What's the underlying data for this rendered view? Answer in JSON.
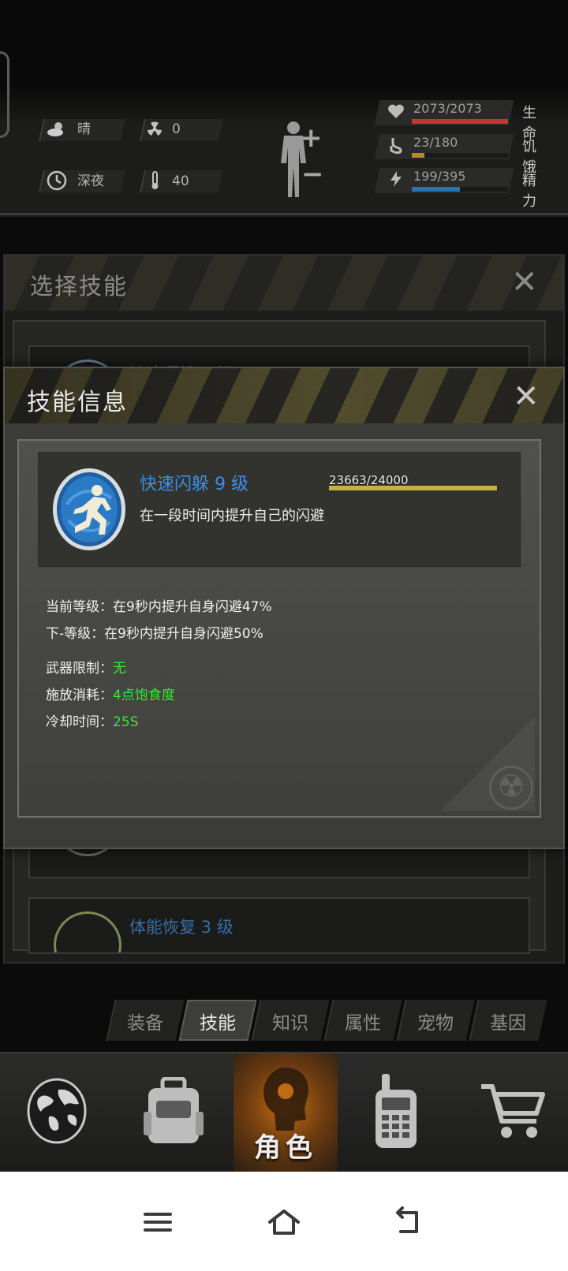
{
  "status": {
    "weather": "晴",
    "radiation": "0",
    "time_of_day": "深夜",
    "temperature": "40"
  },
  "vitals": [
    {
      "value": "2073/2073",
      "label": "生命",
      "color": "#c0392b",
      "fraction": 1.0,
      "icon": "heart-icon"
    },
    {
      "value": "23/180",
      "label": "饥饿",
      "color": "#b58a2a",
      "fraction": 0.128,
      "icon": "stomach-icon"
    },
    {
      "value": "199/395",
      "label": "精力",
      "color": "#2f6fb5",
      "fraction": 0.504,
      "icon": "energy-icon"
    }
  ],
  "select_panel": {
    "title": "选择技能",
    "items": [
      {
        "name": "快速闪躲 9 级"
      },
      {
        "name": "体能恢复 3 级"
      }
    ]
  },
  "info_modal": {
    "title": "技能信息",
    "skill": {
      "name": "快速闪躲 9 级",
      "description": "在一段时间内提升自己的闪避",
      "exp_text": "23663/24000",
      "exp_fraction": 0.986
    },
    "current_level": "当前等级：在9秒内提升自身闪避47%",
    "next_level": "下-等级：在9秒内提升自身闪避50%",
    "weapon_label": "武器限制：",
    "weapon_value": "无",
    "cost_label": "施放消耗：",
    "cost_value": "4点饱食度",
    "cooldown_label": "冷却时间：",
    "cooldown_value": "25S"
  },
  "tabs": [
    {
      "label": "装备",
      "active": false
    },
    {
      "label": "技能",
      "active": true
    },
    {
      "label": "知识",
      "active": false
    },
    {
      "label": "属性",
      "active": false
    },
    {
      "label": "宠物",
      "active": false
    },
    {
      "label": "基因",
      "active": false
    }
  ],
  "bottom_nav": {
    "active_label": "角色",
    "items": [
      "globe-icon",
      "backpack-icon",
      "character-icon",
      "radio-icon",
      "cart-icon"
    ]
  },
  "colors": {
    "accent_blue": "#3e8ee8",
    "value_green": "#38e83a",
    "exp_bar": "#c8b043",
    "nav_active": "#c06a12"
  }
}
